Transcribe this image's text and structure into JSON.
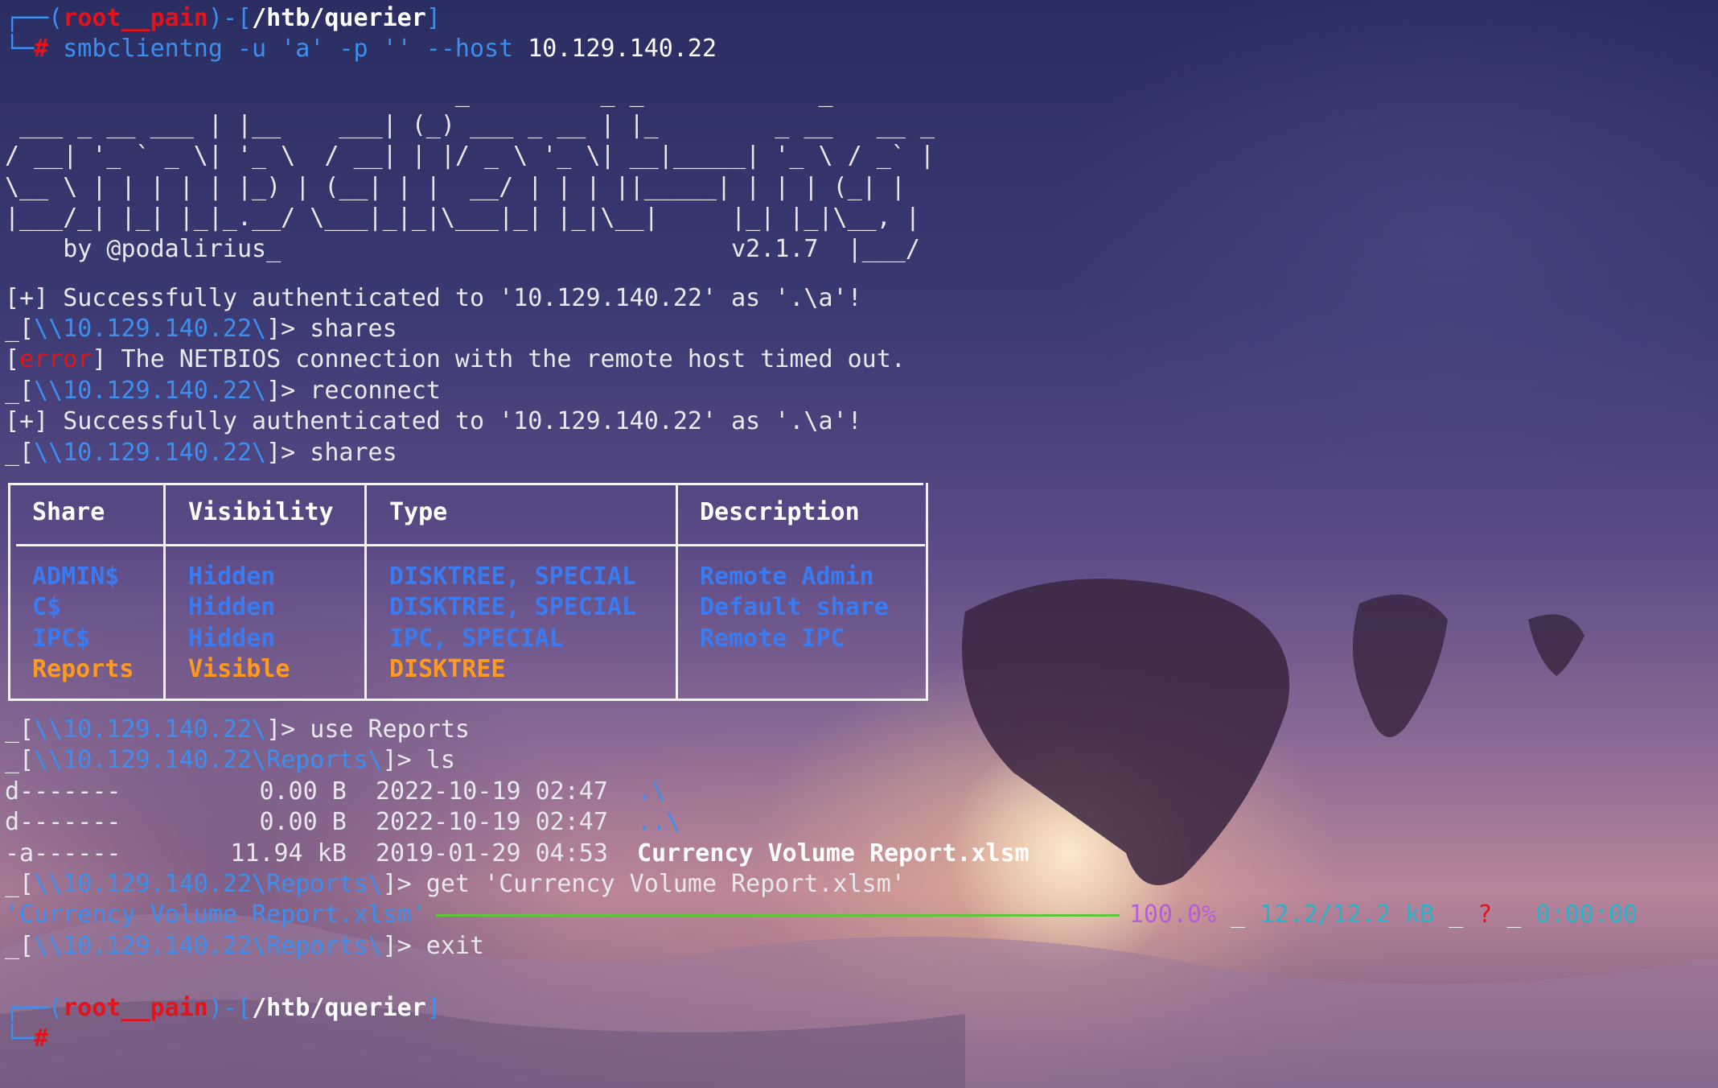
{
  "prompt1": {
    "user": "root__pain",
    "path": "/htb/querier",
    "command_bin": "smbclientng",
    "command_args": " -u 'a' -p '' --host ",
    "command_host": "10.129.140.22"
  },
  "banner": {
    "art": "                               _         _ _            _\n ___ _ __ ___ | |__    ___| (_) ___ _ __ | |_        _ __   __ _\n/ __| '_ ` _ \\| '_ \\  / __| | |/ _ \\ '_ \\| __|_____| '_ \\ / _` |\n\\__ \\ | | | | | |_) | (__| | |  __/ | | | ||_____| | | | (_| |\n|___/_| |_| |_|_.__/ \\___|_|_|\\___|_| |_|\\__|     |_| |_|\\__, |\n    by @podalirius_                               v2.1.7  |___/"
  },
  "log": {
    "auth_prefix": "[+]",
    "auth_msg": " Successfully authenticated to '10.129.140.22' as '.\\a'!",
    "prompt_open": "_[",
    "share_path": "\\\\10.129.140.22\\",
    "prompt_close": "]> ",
    "cmd_shares": "shares",
    "error_open": "[",
    "error_tag": "error",
    "error_msg": "] The NETBIOS connection with the remote host timed out.",
    "cmd_reconnect": "reconnect",
    "cmd_use": "use Reports",
    "reports_path": "\\\\10.129.140.22\\Reports\\",
    "cmd_ls": "ls",
    "cmd_get": "get 'Currency Volume Report.xlsm'",
    "cmd_exit": "exit"
  },
  "shares_table": {
    "headers": [
      "Share",
      "Visibility",
      "Type",
      "Description"
    ],
    "rows": [
      {
        "share": "ADMIN$",
        "visibility": "Hidden",
        "type": "DISKTREE, SPECIAL",
        "description": "Remote Admin"
      },
      {
        "share": "C$",
        "visibility": "Hidden",
        "type": "DISKTREE, SPECIAL",
        "description": "Default share"
      },
      {
        "share": "IPC$",
        "visibility": "Hidden",
        "type": "IPC, SPECIAL",
        "description": "Remote IPC"
      },
      {
        "share": "Reports",
        "visibility": "Visible",
        "type": "DISKTREE",
        "description": ""
      }
    ]
  },
  "listing": [
    {
      "perm": "d-------",
      "size": "0.00 B",
      "date": "2022-10-19 02:47",
      "name": ".\\"
    },
    {
      "perm": "d-------",
      "size": "0.00 B",
      "date": "2022-10-19 02:47",
      "name": "..\\"
    },
    {
      "perm": "-a------",
      "size": "11.94 kB",
      "date": "2019-01-29 04:53",
      "name": "Currency Volume Report.xlsm"
    }
  ],
  "download": {
    "file": "'Currency Volume Report.xlsm'",
    "percent": "100.0%",
    "sep": "_",
    "size": "12.2/12.2 kB",
    "speed": "?",
    "eta": "0:00:00",
    "progress": 1.0
  },
  "prompt2": {
    "user": "root__pain",
    "path": "/htb/querier",
    "symbol": "#"
  },
  "colors": {
    "red": "#e2141a",
    "blue": "#3d8fef",
    "orange": "#ff9a1e",
    "green": "#5ec63a",
    "purple": "#b55fd6",
    "cyan": "#26b3c7"
  }
}
